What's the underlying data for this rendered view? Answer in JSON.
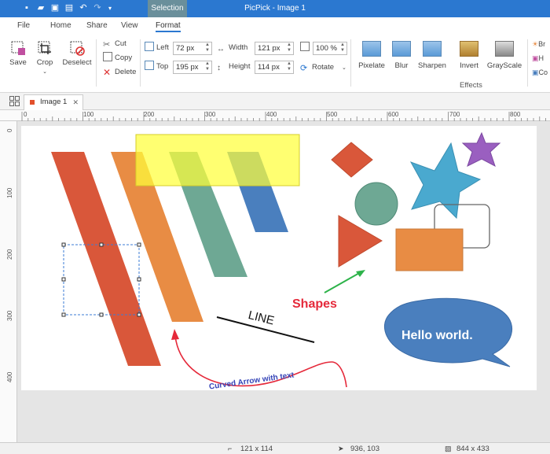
{
  "titlebar": {
    "title": "PicPick - Image 1",
    "selection_tab": "Selection",
    "quick_access": [
      "new-icon",
      "open-icon",
      "save-icon",
      "print-icon",
      "undo-icon",
      "redo-icon",
      "customize-icon"
    ]
  },
  "ribbon_tabs": [
    "File",
    "Home",
    "Share",
    "View",
    "Format"
  ],
  "ribbon": {
    "save": "Save",
    "crop": "Crop",
    "deselect": "Deselect",
    "cut": "Cut",
    "copy": "Copy",
    "delete": "Delete",
    "left_label": "Left",
    "left_value": "72 px",
    "top_label": "Top",
    "top_value": "195 px",
    "width_label": "Width",
    "width_value": "121 px",
    "height_label": "Height",
    "height_value": "114 px",
    "zoom_value": "100 %",
    "rotate": "Rotate",
    "effects": [
      "Pixelate",
      "Blur",
      "Sharpen",
      "Invert",
      "GrayScale"
    ],
    "effects_group": "Effects",
    "overflow": [
      "Br",
      "H",
      "Co"
    ]
  },
  "doc_tab": {
    "label": "Image 1"
  },
  "ruler_top": [
    "0",
    "100",
    "200",
    "300",
    "400",
    "500",
    "600",
    "700",
    "800"
  ],
  "ruler_left": [
    "0",
    "100",
    "200",
    "300",
    "400"
  ],
  "canvas": {
    "shapes_label": "Shapes",
    "line_label": "LINE",
    "curve_label": "Curved Arrow with text",
    "bubble_label": "Hello world.",
    "colors": {
      "red": "#d9573a",
      "orange": "#e88c44",
      "teal": "#6ea894",
      "blue": "#4a7fbe",
      "yellow": "#ffff3a",
      "purple": "#9a5fc0",
      "cyan": "#4aa9cf"
    }
  },
  "status": {
    "selection_size": "121 x 114",
    "cursor_pos": "936, 103",
    "image_size": "844 x 433"
  }
}
